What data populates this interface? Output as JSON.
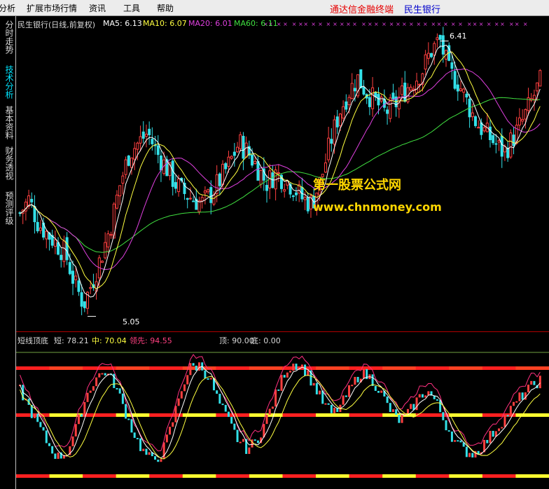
{
  "menubar": {
    "items": [
      "分析",
      "扩展市场行情",
      "资讯",
      "工具",
      "帮助"
    ],
    "brand_text": "通达信金融终端",
    "stock_name": "民生银行"
  },
  "side_tabs": [
    "分时走势",
    "技术分析",
    "基本资料",
    "财务透视",
    "预测评级"
  ],
  "main_chart": {
    "title": "民生银行(日线,前复权)",
    "ma5": "MA5: 6.13",
    "ma10": "MA10: 6.07",
    "ma20": "MA20: 6.01",
    "ma60": "MA60: 6.11",
    "high_label": "6.41",
    "low_label": "5.05",
    "marker_symbol": "×",
    "watermark_cn": "第一股票公式网",
    "watermark_url": "www.chnmoney.com"
  },
  "sub_chart": {
    "title": "短线顶底",
    "short": "短: 78.21",
    "mid": "中: 70.04",
    "lead": "领先: 94.55",
    "top": "顶: 90.00",
    "bottom": "底: 0.00"
  },
  "colors": {
    "up": "#ff4040",
    "down": "#33e0e8",
    "ma5": "#ffffff",
    "ma10": "#ffff40",
    "ma20": "#e040e0",
    "ma60": "#40e040",
    "brand_red": "#e60000",
    "brand_blue": "#0000cc"
  },
  "chart_data": {
    "type": "candlestick",
    "price_range": [
      5.0,
      6.45
    ],
    "high": 6.41,
    "low": 5.05,
    "ma_values": {
      "MA5": 6.13,
      "MA10": 6.07,
      "MA20": 6.01,
      "MA60": 6.11
    },
    "close_path": [
      5.55,
      5.62,
      5.5,
      5.45,
      5.4,
      5.35,
      5.2,
      5.1,
      5.22,
      5.35,
      5.5,
      5.7,
      5.85,
      5.9,
      5.95,
      5.85,
      5.78,
      5.7,
      5.65,
      5.62,
      5.6,
      5.65,
      5.72,
      5.8,
      5.9,
      5.85,
      5.78,
      5.7,
      5.75,
      5.72,
      5.68,
      5.62,
      5.6,
      5.72,
      5.9,
      6.05,
      6.15,
      6.22,
      6.15,
      6.1,
      6.05,
      6.08,
      6.15,
      6.2,
      6.25,
      6.35,
      6.41,
      6.25,
      6.2,
      6.1,
      6.0,
      5.95,
      5.9,
      5.85,
      5.92,
      6.0,
      6.1,
      6.2
    ],
    "oscillator": {
      "range": [
        0,
        100
      ],
      "top_level": 90,
      "bottom_level": 0,
      "short": 78.21,
      "mid": 70.04,
      "lead": 94.55,
      "short_path": [
        70,
        55,
        40,
        25,
        15,
        20,
        40,
        65,
        80,
        85,
        75,
        55,
        35,
        20,
        12,
        18,
        40,
        70,
        88,
        90,
        80,
        60,
        45,
        30,
        22,
        28,
        45,
        65,
        85,
        92,
        88,
        75,
        60,
        50,
        58,
        72,
        84,
        80,
        70,
        55,
        45,
        50,
        62,
        70,
        60,
        42,
        28,
        20,
        18,
        25,
        35,
        45,
        55,
        65,
        72,
        78
      ]
    }
  }
}
